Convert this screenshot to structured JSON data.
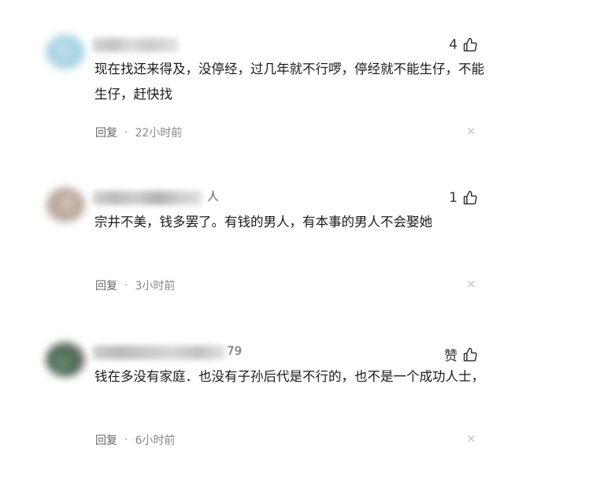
{
  "comments": [
    {
      "name_suffix": "",
      "likes": "4",
      "text": "现在找还来得及，没停经，过几年就不行啰，停经就不能生仔，不能生仔，赶快找",
      "reply_label": "回复",
      "separator": "·",
      "time": "22小时前",
      "close_glyph": "×"
    },
    {
      "name_suffix": "人",
      "likes": "1",
      "text": "宗井不美，钱多罢了。有钱的男人，有本事的男人不会娶她",
      "reply_label": "回复",
      "separator": "·",
      "time": "3小时前",
      "close_glyph": "×"
    },
    {
      "name_suffix": "79",
      "likes": "赞",
      "text": "钱在多没有家庭．也没有子孙后代是不行的，也不是一个成功人士，",
      "reply_label": "回复",
      "separator": "·",
      "time": "6小时前",
      "close_glyph": "×"
    }
  ]
}
